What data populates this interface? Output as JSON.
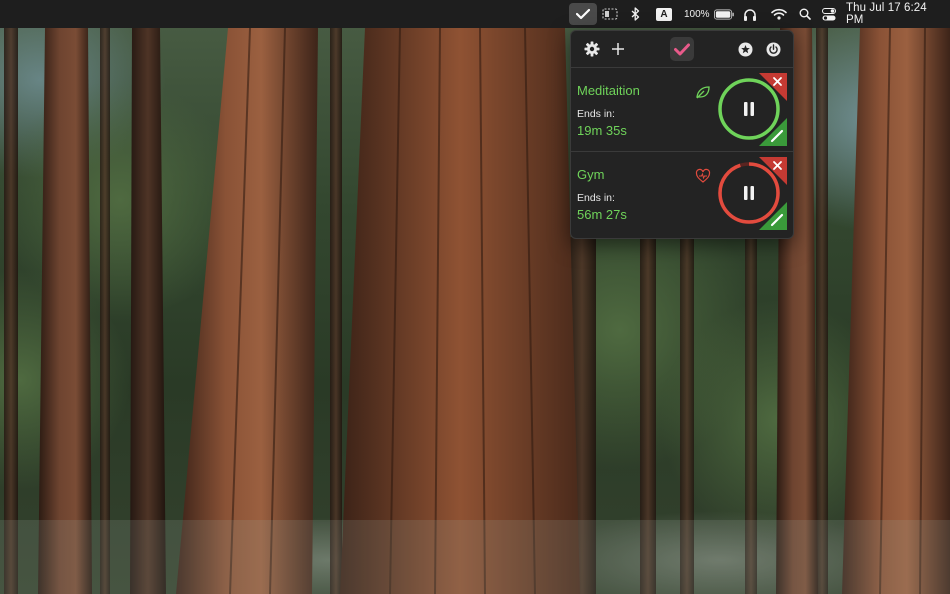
{
  "menubar": {
    "battery_percent": "100%",
    "clock": "Thu Jul 17  6:24 PM",
    "input_source": "A",
    "icons": [
      "checkmark-app-icon",
      "screen-mirroring-icon",
      "bluetooth-icon",
      "input-source-icon",
      "battery-icon",
      "headphones-icon",
      "wifi-icon",
      "spotlight-search-icon",
      "control-center-icon"
    ]
  },
  "popover": {
    "toolbar_icons": [
      "gear-icon",
      "plus-icon",
      "app-logo-icon",
      "star-icon",
      "power-icon"
    ],
    "timers": [
      {
        "name": "Meditaition",
        "ends_label": "Ends in:",
        "remaining": "19m 35s",
        "color": "#6fd35a",
        "category_icon": "leaf-icon",
        "progress": 1.0
      },
      {
        "name": "Gym",
        "ends_label": "Ends in:",
        "remaining": "56m 27s",
        "color": "#e24b3e",
        "category_icon": "heart-pulse-icon",
        "progress": 0.95
      }
    ]
  },
  "colors": {
    "menubar_bg": "#1e1e1e",
    "popover_bg": "#232323",
    "close_corner": "#c53a33",
    "edit_corner": "#3a9a3a",
    "app_accent": "#e85a8a"
  }
}
